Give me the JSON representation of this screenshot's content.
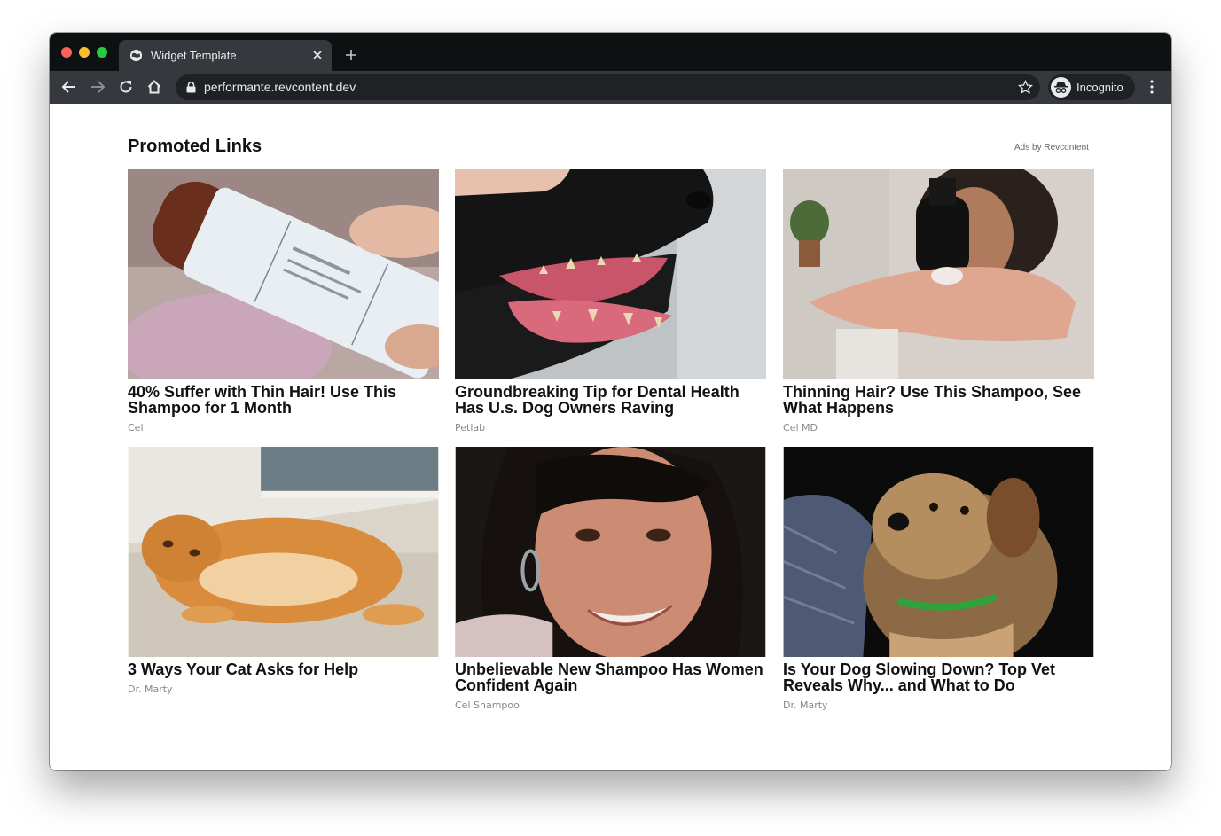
{
  "browser": {
    "tab_title": "Widget Template",
    "url": "performante.revcontent.dev",
    "profile_label": "Incognito"
  },
  "widget": {
    "title": "Promoted Links",
    "ads_by": "Ads by Revcontent",
    "cards": [
      {
        "headline": "40% Suffer with Thin Hair! Use This Shampoo for 1 Month",
        "brand": "Cel",
        "image": "shampoo-bottle-photo"
      },
      {
        "headline": "Groundbreaking Tip for Dental Health Has U.s. Dog Owners Raving",
        "brand": "Petlab",
        "image": "dog-teeth-photo"
      },
      {
        "headline": "Thinning Hair? Use This Shampoo, See What Happens",
        "brand": "Cel MD",
        "image": "pump-bottle-hand-photo"
      },
      {
        "headline": "3 Ways Your Cat Asks for Help",
        "brand": "Dr. Marty",
        "image": "orange-cat-photo"
      },
      {
        "headline": "Unbelievable New Shampoo Has Women Confident Again",
        "brand": "Cel Shampoo",
        "image": "smiling-woman-photo"
      },
      {
        "headline": "Is Your Dog Slowing Down? Top Vet Reveals Why... and What to Do",
        "brand": "Dr. Marty",
        "image": "terrier-dog-photo"
      }
    ]
  }
}
